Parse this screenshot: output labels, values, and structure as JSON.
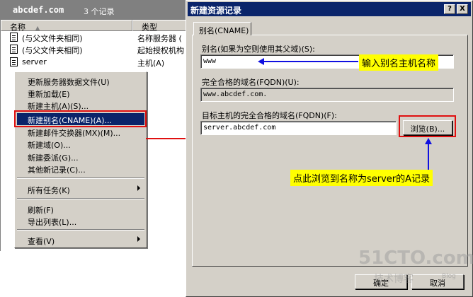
{
  "zone": {
    "name": "abcdef.com",
    "count": "3 个记录"
  },
  "list": {
    "col_name": "名称",
    "col_type": "类型",
    "rows": [
      {
        "name": "(与父文件夹相同)",
        "type": "名称服务器 ("
      },
      {
        "name": "(与父文件夹相同)",
        "type": "起始授权机构"
      },
      {
        "name": "server",
        "type": "主机(A)"
      }
    ]
  },
  "context_menu": {
    "items": [
      "更新服务器数据文件(U)",
      "重新加载(E)",
      "新建主机(A)(S)...",
      "新建别名(CNAME)(A)...",
      "新建邮件交换器(MX)(M)...",
      "新建域(O)...",
      "新建委派(G)...",
      "其他新记录(C)...",
      "所有任务(K)",
      "刷新(F)",
      "导出列表(L)...",
      "查看(V)"
    ]
  },
  "dialog": {
    "title": "新建资源记录",
    "help_btn": "?",
    "close_btn": "X",
    "tab_label": "别名(CNAME)",
    "alias_label": "别名(如果为空则使用其父域)(S):",
    "alias_value": "www",
    "fqdn_label": "完全合格的域名(FQDN)(U):",
    "fqdn_value": "www.abcdef.com.",
    "target_label": "目标主机的完全合格的域名(FQDN)(F):",
    "target_value": "server.abcdef.com",
    "browse_btn": "浏览(B)...",
    "ok_btn": "确定",
    "cancel_btn": "取消"
  },
  "annotations": {
    "alias_hint": "输入别名主机名称",
    "browse_hint": "点此浏览到名称为server的A记录"
  },
  "watermark": {
    "main": "51CTO.com",
    "sub": "技术博客",
    "blog": "Blog"
  },
  "colors": {
    "highlight": "#0a246a",
    "callout": "#ffff00",
    "red": "#e01010",
    "blue": "#1010e0"
  }
}
